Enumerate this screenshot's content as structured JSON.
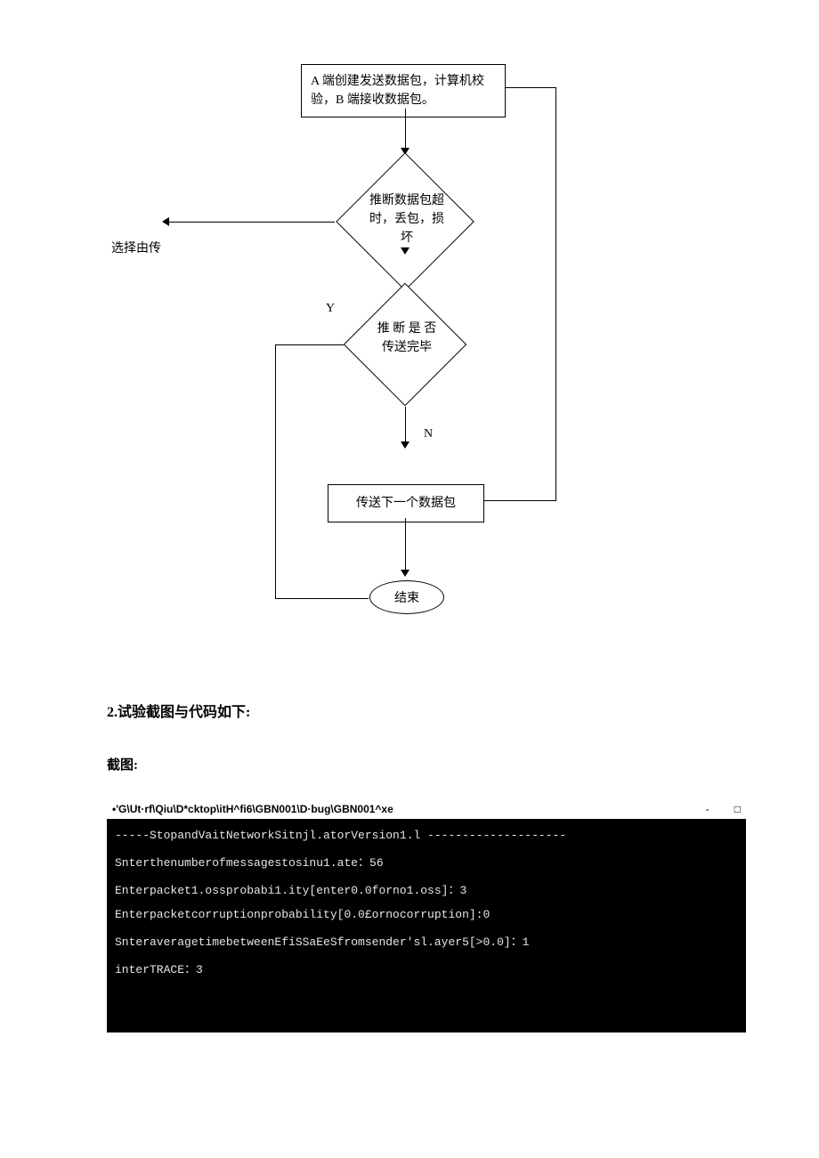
{
  "flowchart": {
    "box_top_l1": "A 端创建发送数据包，计算机校",
    "box_top_l2": "验，B 端接收数据包。",
    "diamond1_l1": "推断数据包超",
    "diamond1_l2": "时，丢包，损",
    "diamond1_l3": "坏",
    "diamond2_l1": "推 断 是 否",
    "diamond2_l2": "传送完毕",
    "box_next": "传送下一个数据包",
    "end": "结束",
    "label_y": "Y",
    "label_n": "N",
    "left_caption": "选择由传"
  },
  "section": {
    "heading2": "2.试验截图与代码如下:",
    "sub": "截图:"
  },
  "terminal": {
    "title": "•'G\\Ut·rf\\Qiu\\D*cktop\\itH^fi6\\GBN001\\D·bug\\GBN001^xe",
    "minimize": "-",
    "maximize": "□",
    "lines": [
      "-----StopandVaitNetworkSitnjl.atorVersion1.l --------------------",
      "Snterthenumberofmessagestosinu1.ate：56",
      "Enterpacket1.ossprobabi1.ity[enter0.0forno1.oss]：3",
      "Enterpacketcorruptionprobability[0.0£ornocorruption]:0",
      "SnteraveragetimebetweenEfiSSaEeSfromsender'sl.ayer5[>0.0]：1",
      "interTRACE：3"
    ]
  }
}
